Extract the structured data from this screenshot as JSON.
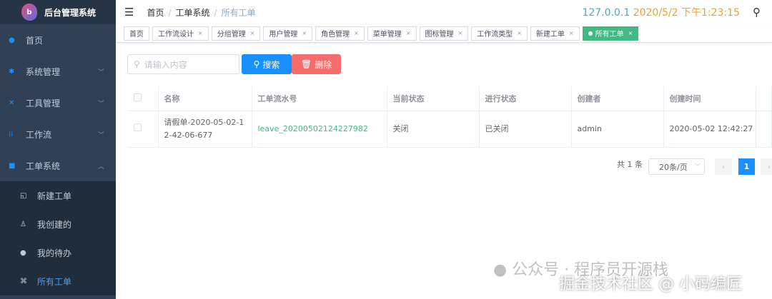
{
  "app": {
    "title": "后台管理系统",
    "logo_letter": "b"
  },
  "sidebar": {
    "items": [
      {
        "label": "首页",
        "icon": "dashboard-icon"
      },
      {
        "label": "系统管理",
        "icon": "gear-icon"
      },
      {
        "label": "工具管理",
        "icon": "tools-icon"
      },
      {
        "label": "工作流",
        "icon": "workflow-icon"
      },
      {
        "label": "工单系统",
        "icon": "clipboard-icon"
      }
    ],
    "sub_items": [
      {
        "label": "新建工单",
        "icon": "new-doc-icon"
      },
      {
        "label": "我创建的",
        "icon": "user-list-icon"
      },
      {
        "label": "我的待办",
        "icon": "chat-icon"
      },
      {
        "label": "所有工单",
        "icon": "grid-icon"
      }
    ]
  },
  "header": {
    "breadcrumb": [
      "首页",
      "工单系统",
      "所有工单"
    ],
    "ip": "127.0.0.1",
    "datetime": "2020/5/2 下午1:23:15"
  },
  "tags": [
    "首页",
    "工作流设计",
    "分组管理",
    "用户管理",
    "角色管理",
    "菜单管理",
    "图标管理",
    "工作流类型",
    "新建工单",
    "所有工单"
  ],
  "toolbar": {
    "placeholder": "请输入内容",
    "search": "搜索",
    "delete": "删除"
  },
  "table": {
    "headers": [
      "名称",
      "工单流水号",
      "当前状态",
      "进行状态",
      "创建者",
      "创建时间"
    ],
    "rows": [
      [
        "请假单-2020-05-02-12-42-06-677",
        "leave_20200502124227982",
        "关闭",
        "已关闭",
        "admin",
        "2020-05-02 12:42:27"
      ]
    ]
  },
  "pagination": {
    "total": "共 1 条",
    "page_size": "20条/页",
    "current": "1"
  },
  "watermark": {
    "line1": "公众号 · 程序员开源栈",
    "line2": "掘金技术社区 @ 小码编匠"
  },
  "colors": {
    "primary": "#1890ff",
    "danger": "#f56c6c",
    "success": "#42b983",
    "ip": "#4aa8d8",
    "time": "#e6a23c"
  }
}
